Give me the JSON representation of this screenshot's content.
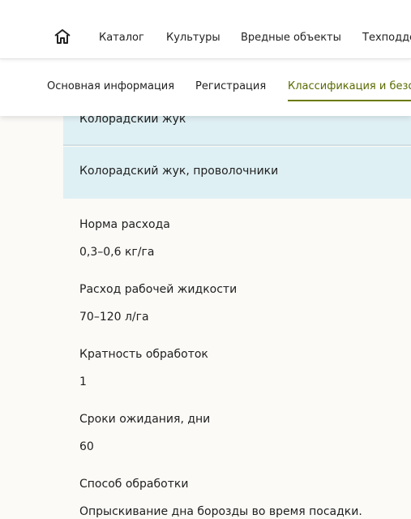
{
  "topnav": {
    "items": [
      "Каталог",
      "Культуры",
      "Вредные объекты",
      "Техподде"
    ]
  },
  "subnav": {
    "tabs": [
      "Основная информация",
      "Регистрация",
      "Классификация и безог"
    ],
    "active_index": 2
  },
  "pests": [
    "Колорадский жук",
    "Колорадский жук, проволочники"
  ],
  "fields": [
    {
      "label": "Норма расхода",
      "value": "0,3–0,6 кг/га"
    },
    {
      "label": "Расход рабочей жидкости",
      "value": "70–120 л/га"
    },
    {
      "label": "Кратность обработок",
      "value": "1"
    },
    {
      "label": "Сроки ожидания, дни",
      "value": "60"
    },
    {
      "label": "Способ обработки",
      "value": "Опрыскивание дна борозды во время посадки."
    }
  ],
  "colors": {
    "accent": "#6b7a00",
    "row_highlight": "#dff0f4"
  }
}
